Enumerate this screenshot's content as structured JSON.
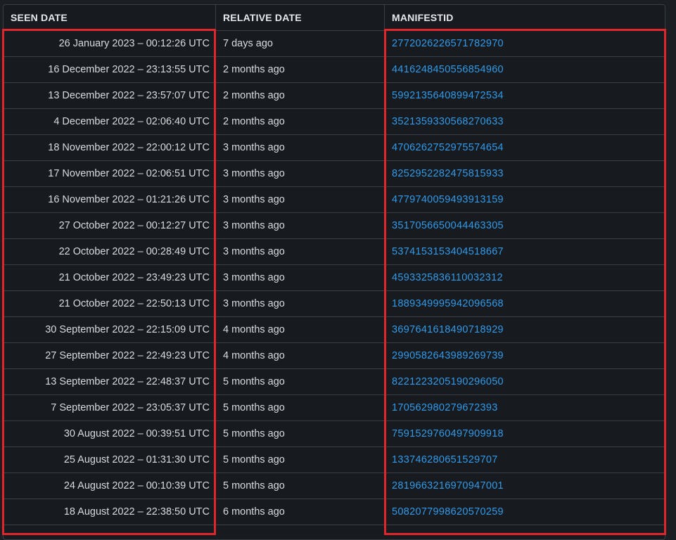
{
  "table": {
    "headers": {
      "seen_date": "SEEN DATE",
      "relative_date": "RELATIVE DATE",
      "manifest_id": "MANIFESTID"
    },
    "rows": [
      {
        "seen": "26 January 2023 – 00:12:26 UTC",
        "relative": "7 days ago",
        "manifest": "2772026226571782970"
      },
      {
        "seen": "16 December 2022 – 23:13:55 UTC",
        "relative": "2 months ago",
        "manifest": "4416248450556854960"
      },
      {
        "seen": "13 December 2022 – 23:57:07 UTC",
        "relative": "2 months ago",
        "manifest": "5992135640899472534"
      },
      {
        "seen": "4 December 2022 – 02:06:40 UTC",
        "relative": "2 months ago",
        "manifest": "3521359330568270633"
      },
      {
        "seen": "18 November 2022 – 22:00:12 UTC",
        "relative": "3 months ago",
        "manifest": "4706262752975574654"
      },
      {
        "seen": "17 November 2022 – 02:06:51 UTC",
        "relative": "3 months ago",
        "manifest": "8252952282475815933"
      },
      {
        "seen": "16 November 2022 – 01:21:26 UTC",
        "relative": "3 months ago",
        "manifest": "4779740059493913159"
      },
      {
        "seen": "27 October 2022 – 00:12:27 UTC",
        "relative": "3 months ago",
        "manifest": "3517056650044463305"
      },
      {
        "seen": "22 October 2022 – 00:28:49 UTC",
        "relative": "3 months ago",
        "manifest": "5374153153404518667"
      },
      {
        "seen": "21 October 2022 – 23:49:23 UTC",
        "relative": "3 months ago",
        "manifest": "4593325836110032312"
      },
      {
        "seen": "21 October 2022 – 22:50:13 UTC",
        "relative": "3 months ago",
        "manifest": "1889349995942096568"
      },
      {
        "seen": "30 September 2022 – 22:15:09 UTC",
        "relative": "4 months ago",
        "manifest": "3697641618490718929"
      },
      {
        "seen": "27 September 2022 – 22:49:23 UTC",
        "relative": "4 months ago",
        "manifest": "2990582643989269739"
      },
      {
        "seen": "13 September 2022 – 22:48:37 UTC",
        "relative": "5 months ago",
        "manifest": "8221223205190296050"
      },
      {
        "seen": "7 September 2022 – 23:05:37 UTC",
        "relative": "5 months ago",
        "manifest": "170562980279672393"
      },
      {
        "seen": "30 August 2022 – 00:39:51 UTC",
        "relative": "5 months ago",
        "manifest": "7591529760497909918"
      },
      {
        "seen": "25 August 2022 – 01:31:30 UTC",
        "relative": "5 months ago",
        "manifest": "133746280651529707"
      },
      {
        "seen": "24 August 2022 – 00:10:39 UTC",
        "relative": "5 months ago",
        "manifest": "2819663216970947001"
      },
      {
        "seen": "18 August 2022 – 22:38:50 UTC",
        "relative": "6 months ago",
        "manifest": "5082077998620570259"
      }
    ]
  },
  "colors": {
    "background": "#171a1f",
    "link": "#2f9bea",
    "highlight": "#e0262b",
    "border": "#3a3f47"
  }
}
